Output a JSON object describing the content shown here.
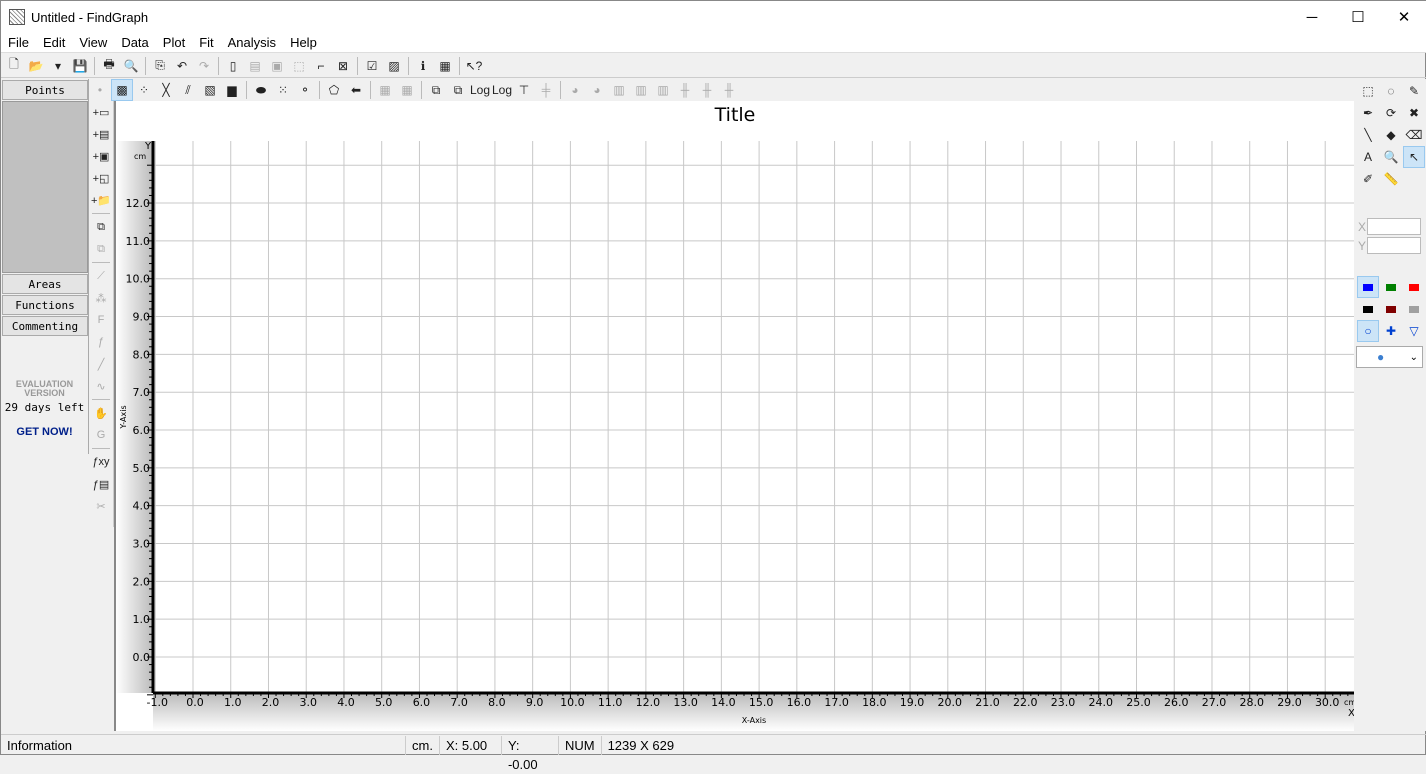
{
  "window": {
    "title": "Untitled - FindGraph",
    "minimize": "─",
    "maximize": "☐",
    "close": "✕"
  },
  "menu": [
    "File",
    "Edit",
    "View",
    "Data",
    "Plot",
    "Fit",
    "Analysis",
    "Help"
  ],
  "toolbar_main": [
    {
      "n": "new-icon",
      "g": "🗋"
    },
    {
      "n": "open-icon",
      "g": "📂"
    },
    {
      "n": "dropdown-arrow-icon",
      "g": "▾"
    },
    {
      "n": "save-icon",
      "g": "💾"
    },
    "|",
    {
      "n": "print-icon",
      "g": "🖶"
    },
    {
      "n": "print-preview-icon",
      "g": "🔍"
    },
    "|",
    {
      "n": "copy-icon",
      "g": "⎘"
    },
    {
      "n": "undo-icon",
      "g": "↶"
    },
    {
      "n": "redo-icon",
      "g": "↷",
      "d": true
    },
    "|",
    {
      "n": "page-icon",
      "g": "▯"
    },
    {
      "n": "page-gray-icon",
      "g": "▤",
      "d": true
    },
    {
      "n": "page-frame-icon",
      "g": "▣",
      "d": true
    },
    {
      "n": "selection-icon",
      "g": "⬚",
      "d": true
    },
    {
      "n": "scale-icon",
      "g": "⌐"
    },
    {
      "n": "fit-icon",
      "g": "⊠"
    },
    "|",
    {
      "n": "checklist-icon",
      "g": "☑"
    },
    {
      "n": "image-icon",
      "g": "▨"
    },
    "|",
    {
      "n": "info-icon",
      "g": "ℹ"
    },
    {
      "n": "table-icon",
      "g": "▦"
    },
    "|",
    {
      "n": "help-cursor-icon",
      "g": "↖?"
    }
  ],
  "toolbar_plot": [
    {
      "n": "dot-icon",
      "g": "•",
      "d": true
    },
    {
      "n": "points-icon",
      "g": "▩",
      "s": true
    },
    {
      "n": "scatter-icon",
      "g": "⁘"
    },
    {
      "n": "line-cross-icon",
      "g": "╳"
    },
    {
      "n": "parallel-lines-icon",
      "g": "⫽"
    },
    {
      "n": "hatched-icon",
      "g": "▧"
    },
    {
      "n": "histogram-icon",
      "g": "▆"
    },
    "|",
    {
      "n": "ellipse-fill-icon",
      "g": "⬬"
    },
    {
      "n": "dots-icon",
      "g": "⁙"
    },
    {
      "n": "circles-icon",
      "g": "⚬"
    },
    "|",
    {
      "n": "polygon-icon",
      "g": "⬠"
    },
    {
      "n": "arrow-left-icon",
      "g": "⬅"
    },
    "|",
    {
      "n": "layers-icon",
      "g": "▦",
      "d": true
    },
    {
      "n": "layers2-icon",
      "g": "▦",
      "d": true
    },
    "|",
    {
      "n": "window-icon",
      "g": "⧉"
    },
    {
      "n": "window2-icon",
      "g": "⧉"
    },
    {
      "n": "log-x-icon",
      "g": "Log"
    },
    {
      "n": "log-y-icon",
      "g": "Log"
    },
    {
      "n": "axis-icon",
      "g": "⊤"
    },
    {
      "n": "axis-gray-icon",
      "g": "╪",
      "d": true
    },
    "|",
    {
      "n": "pie-icon",
      "g": "◕",
      "d": true
    },
    {
      "n": "pie2-icon",
      "g": "◕",
      "d": true
    },
    {
      "n": "bars-icon",
      "g": "▥",
      "d": true
    },
    {
      "n": "bars2-icon",
      "g": "▥",
      "d": true
    },
    {
      "n": "bars3-icon",
      "g": "▥",
      "d": true
    },
    {
      "n": "boxplot-icon",
      "g": "╫",
      "d": true
    },
    {
      "n": "boxplot2-icon",
      "g": "╫",
      "d": true
    },
    {
      "n": "candlestick-icon",
      "g": "╫",
      "d": true
    }
  ],
  "left_tools": [
    {
      "n": "add-point-icon",
      "g": "+▭"
    },
    {
      "n": "add-table-icon",
      "g": "+▤"
    },
    {
      "n": "add-image-icon",
      "g": "+▣"
    },
    {
      "n": "add-area-icon",
      "g": "+◱"
    },
    {
      "n": "add-folder-icon",
      "g": "+📁"
    },
    "|",
    {
      "n": "copy-data-icon",
      "g": "⧉"
    },
    {
      "n": "paste-data-icon",
      "g": "⧉",
      "d": true
    },
    "|",
    {
      "n": "fit-line-icon",
      "g": "⟋",
      "d": true
    },
    {
      "n": "fit-scatter-icon",
      "g": "⁂",
      "d": true
    },
    {
      "n": "function-box-icon",
      "g": "F",
      "d": true
    },
    {
      "n": "function-plot-icon",
      "g": "ƒ",
      "d": true
    },
    {
      "n": "regression-icon",
      "g": "╱",
      "d": true
    },
    {
      "n": "curve-icon",
      "g": "∿",
      "d": true
    },
    "|",
    {
      "n": "hand-icon",
      "g": "✋",
      "d": true
    },
    {
      "n": "gauss-icon",
      "g": "G",
      "d": true
    },
    "|",
    {
      "n": "function-xy-icon",
      "g": "ƒxy"
    },
    {
      "n": "function-table-icon",
      "g": "ƒ▤"
    },
    {
      "n": "scissors-icon",
      "g": "✂",
      "d": true
    }
  ],
  "left_panel": {
    "points": "Points",
    "areas": "Areas",
    "functions": "Functions",
    "commenting": "Commenting",
    "eval1": "EVALUATION",
    "eval2": "VERSION",
    "days_left": "29 days left",
    "get_now": "GET NOW!"
  },
  "right_tools": [
    {
      "n": "rect-select-icon",
      "g": "⬚"
    },
    {
      "n": "lasso-icon",
      "g": "◌"
    },
    {
      "n": "edit-icon",
      "g": "✎"
    },
    {
      "n": "pipette-icon",
      "g": "✒"
    },
    {
      "n": "rotate-icon",
      "g": "⟳"
    },
    {
      "n": "delete-points-icon",
      "g": "✖"
    },
    {
      "n": "line-tool-icon",
      "g": "╲"
    },
    {
      "n": "fill-icon",
      "g": "◆"
    },
    {
      "n": "eraser-icon",
      "g": "⌫"
    },
    {
      "n": "text-tool-icon",
      "g": "A"
    },
    {
      "n": "zoom-icon",
      "g": "🔍",
      "d": true
    },
    {
      "n": "pointer-xy-icon",
      "g": "↖",
      "s": true
    },
    {
      "n": "pen-icon",
      "g": "✐"
    },
    {
      "n": "ruler-icon",
      "g": "📏"
    }
  ],
  "coords": {
    "x_label": "X",
    "y_label": "Y"
  },
  "colors": [
    {
      "n": "color-blue",
      "c": "#0000ff",
      "s": true
    },
    {
      "n": "color-green",
      "c": "#008000"
    },
    {
      "n": "color-red",
      "c": "#ff0000"
    },
    {
      "n": "color-black",
      "c": "#000000"
    },
    {
      "n": "color-darkred",
      "c": "#800000"
    },
    {
      "n": "color-gray",
      "c": "#a0a0a0"
    }
  ],
  "markers": [
    {
      "n": "circle-marker-icon",
      "g": "○",
      "s": true
    },
    {
      "n": "cross-marker-icon",
      "g": "✚"
    },
    {
      "n": "triangle-marker-icon",
      "g": "▽"
    }
  ],
  "marker_select": "●",
  "chart": {
    "title": "Title",
    "xlabel": "X-Axis",
    "ylabel": "Y-Axis",
    "x_unit": "cm",
    "y_unit": "cm",
    "x_name": "X",
    "y_name": "Y",
    "xlim": [
      -1,
      30
    ],
    "ylim": [
      -1,
      13
    ],
    "x_ticks": [
      -1,
      0,
      1,
      2,
      3,
      4,
      5,
      6,
      7,
      8,
      9,
      10,
      11,
      12,
      13,
      14,
      15,
      16,
      17,
      18,
      19,
      20,
      21,
      22,
      23,
      24,
      25,
      26,
      27,
      28,
      29,
      30
    ],
    "y_ticks": [
      0,
      1,
      2,
      3,
      4,
      5,
      6,
      7,
      8,
      9,
      10,
      11,
      12
    ]
  },
  "status": {
    "info": "Information",
    "unit": "cm.",
    "x": "X:  5.00",
    "y": "Y: -0.00",
    "num": "NUM",
    "size": "1239 X 629"
  }
}
